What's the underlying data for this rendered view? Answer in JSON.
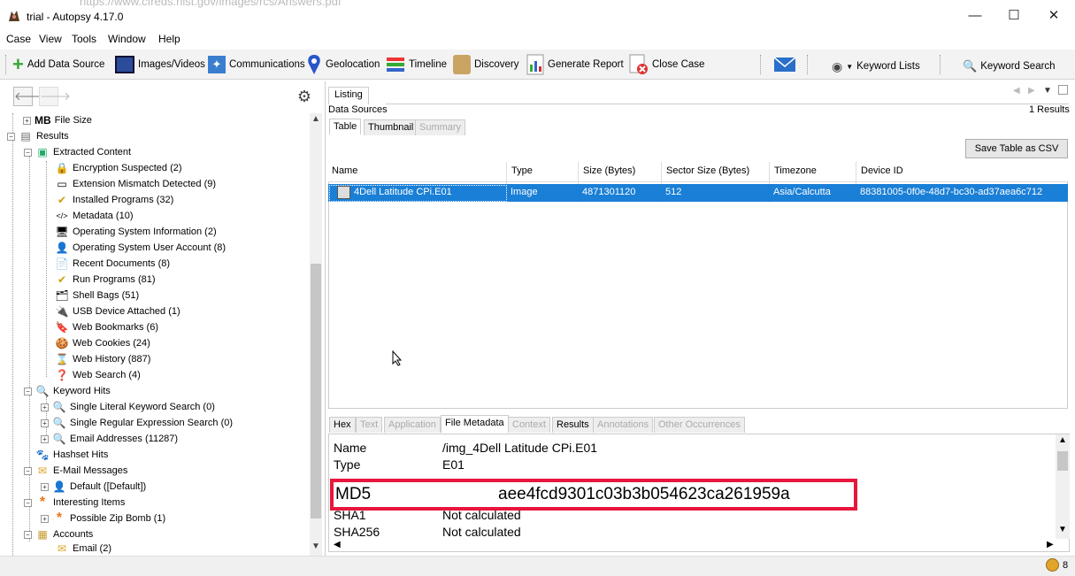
{
  "window": {
    "url_ghost": "https://www.cfreds.nist.gov/images/rcs/Answers.pdf",
    "title": "trial - Autopsy 4.17.0",
    "min": "—",
    "max": "☐",
    "close": "✕"
  },
  "menu": [
    "Case",
    "View",
    "Tools",
    "Window",
    "Help"
  ],
  "toolbar": {
    "add_data_source": "Add Data Source",
    "images_videos": "Images/Videos",
    "communications": "Communications",
    "geolocation": "Geolocation",
    "timeline": "Timeline",
    "discovery": "Discovery",
    "generate_report": "Generate Report",
    "close_case": "Close Case",
    "keyword_lists": "Keyword Lists",
    "keyword_search": "Keyword Search"
  },
  "tree": {
    "file_size_prefix": "MB",
    "file_size": "File Size",
    "results": "Results",
    "extracted_content": "Extracted Content",
    "items": [
      {
        "label": "Encryption Suspected (2)",
        "icon": "🔒"
      },
      {
        "label": "Extension Mismatch Detected (9)",
        "icon": "▭"
      },
      {
        "label": "Installed Programs (32)",
        "icon": "✔"
      },
      {
        "label": "Metadata (10)",
        "icon": "</>"
      },
      {
        "label": "Operating System Information (2)",
        "icon": "🖥"
      },
      {
        "label": "Operating System User Account (8)",
        "icon": "👤"
      },
      {
        "label": "Recent Documents (8)",
        "icon": "📄"
      },
      {
        "label": "Run Programs (81)",
        "icon": "✔"
      },
      {
        "label": "Shell Bags (51)",
        "icon": "🗂"
      },
      {
        "label": "USB Device Attached (1)",
        "icon": "🔌"
      },
      {
        "label": "Web Bookmarks (6)",
        "icon": "🔖"
      },
      {
        "label": "Web Cookies (24)",
        "icon": "🍪"
      },
      {
        "label": "Web History (887)",
        "icon": "⌛"
      },
      {
        "label": "Web Search (4)",
        "icon": "❓"
      }
    ],
    "keyword_hits": "Keyword Hits",
    "keyword_items": [
      "Single Literal Keyword Search (0)",
      "Single Regular Expression Search (0)",
      "Email Addresses (11287)"
    ],
    "hashset_hits": "Hashset Hits",
    "email_messages": "E-Mail Messages",
    "email_default": "Default ([Default])",
    "interesting_items": "Interesting Items",
    "zip_bomb": "Possible Zip Bomb (1)",
    "accounts": "Accounts",
    "email": "Email (2)"
  },
  "listing": {
    "tab": "Listing",
    "breadcrumb": "Data Sources",
    "results_count": "1  Results",
    "subtabs": [
      "Table",
      "Thumbnail",
      "Summary"
    ],
    "save_csv": "Save Table as CSV",
    "columns": [
      "Name",
      "Type",
      "Size (Bytes)",
      "Sector Size (Bytes)",
      "Timezone",
      "Device ID"
    ],
    "row": {
      "name": "4Dell Latitude CPi.E01",
      "type": "Image",
      "size": "4871301120",
      "sector": "512",
      "timezone": "Asia/Calcutta",
      "device_id": "88381005-0f0e-48d7-bc30-ad37aea6c712"
    }
  },
  "content_tabs": [
    "Hex",
    "Text",
    "Application",
    "File Metadata",
    "Context",
    "Results",
    "Annotations",
    "Other Occurrences"
  ],
  "metadata": {
    "name_key": "Name",
    "name_val": "/img_4Dell Latitude CPi.E01",
    "type_key": "Type",
    "type_val": "E01",
    "md5_key": "MD5",
    "md5_val": "aee4fcd9301c03b3b054623ca261959a",
    "sha1_key": "SHA1",
    "sha1_val": "Not calculated",
    "sha256_key": "SHA256",
    "sha256_val": "Not calculated"
  },
  "status": {
    "count": "8"
  },
  "colors": {
    "selection": "#1a7fd6",
    "highlight_box": "#e8163c"
  }
}
